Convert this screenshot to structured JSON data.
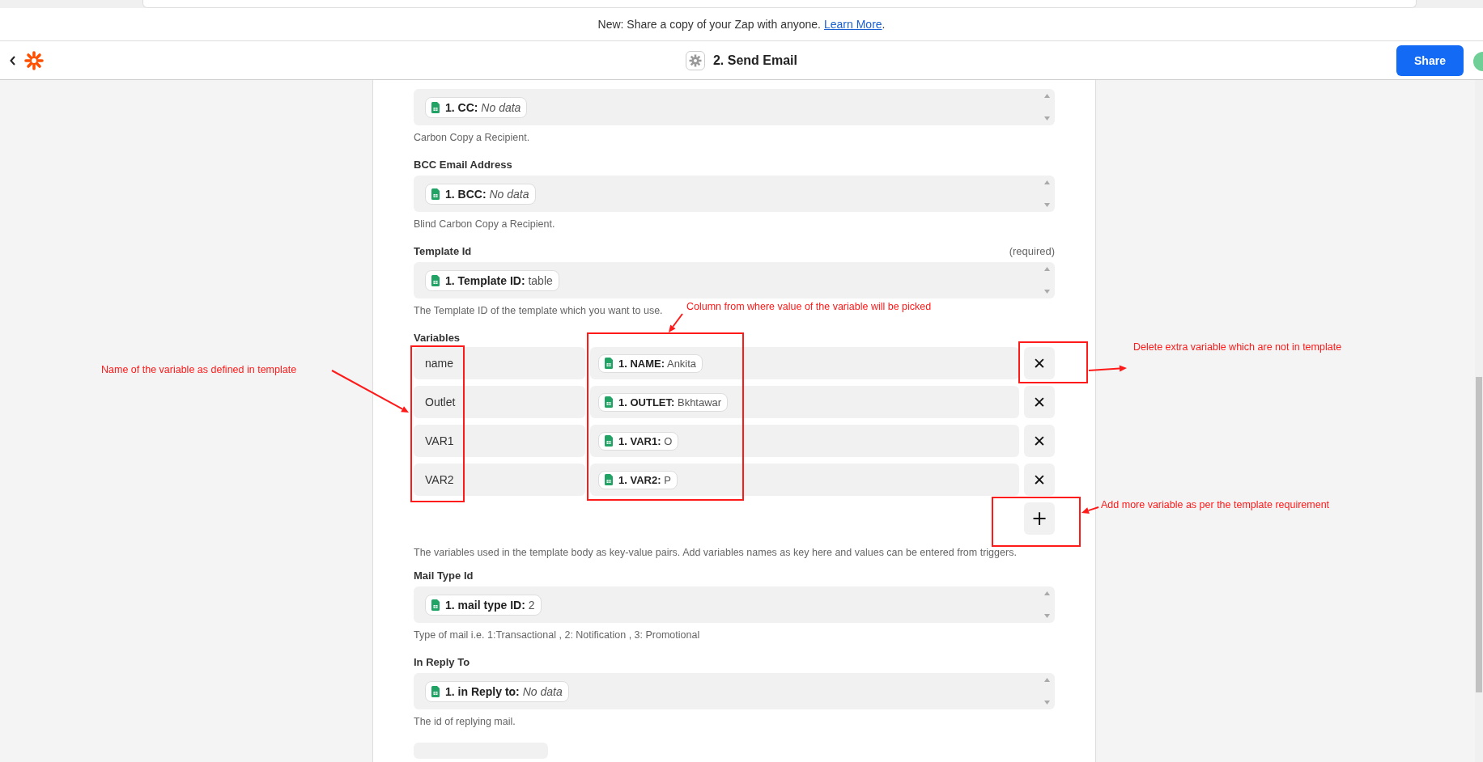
{
  "banner": {
    "text": "New: Share a copy of your Zap with anyone.",
    "link": "Learn More",
    "after": "."
  },
  "header": {
    "title": "2. Send Email",
    "share": "Share"
  },
  "fields_top": [
    {
      "chip": {
        "label": "1. CC:",
        "value": "No data",
        "empty": true
      },
      "hint": "Carbon Copy a Recipient."
    },
    {
      "label": "BCC Email Address",
      "chip": {
        "label": "1. BCC:",
        "value": "No data",
        "empty": true
      },
      "hint": "Blind Carbon Copy a Recipient."
    },
    {
      "label": "Template Id",
      "required": "(required)",
      "chip": {
        "label": "1. Template ID:",
        "value": "table",
        "empty": false
      },
      "hint": "The Template ID of the template which you want to use."
    }
  ],
  "variables": {
    "label": "Variables",
    "rows": [
      {
        "key": "name",
        "chip": {
          "label": "1. NAME:",
          "value": "Ankita"
        },
        "remove": "✕"
      },
      {
        "key": "Outlet",
        "chip": {
          "label": "1. OUTLET:",
          "value": "Bkhtawar"
        },
        "remove": "✕"
      },
      {
        "key": "VAR1",
        "chip": {
          "label": "1. VAR1:",
          "value": "O"
        },
        "remove": "✕"
      },
      {
        "key": "VAR2",
        "chip": {
          "label": "1. VAR2:",
          "value": "P"
        },
        "remove": "✕"
      }
    ],
    "add": "+",
    "hint": "The variables used in the template body as key-value pairs. Add variables names as key here and values can be entered from triggers."
  },
  "fields_bottom": [
    {
      "label": "Mail Type Id",
      "chip": {
        "label": "1. mail type ID:",
        "value": "2",
        "empty": false
      },
      "hint": "Type of mail i.e. 1:Transactional , 2: Notification , 3: Promotional"
    },
    {
      "label": "In Reply To",
      "chip": {
        "label": "1. in Reply to:",
        "value": "No data",
        "empty": true
      },
      "hint": "The id of replying mail."
    }
  ],
  "annotations": [
    {
      "text": "Name of the variable as defined in template"
    },
    {
      "text": "Column from where value of the variable will be picked"
    },
    {
      "text": "Delete extra variable which are not in template"
    },
    {
      "text": "Add more variable as per the template requirement"
    }
  ]
}
